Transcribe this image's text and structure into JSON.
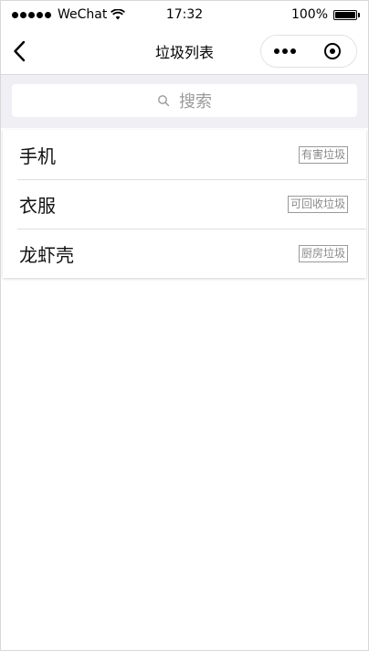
{
  "status_bar": {
    "carrier": "WeChat",
    "time": "17:32",
    "battery": "100%",
    "battery_level": 1.0
  },
  "nav": {
    "title": "垃圾列表"
  },
  "search": {
    "placeholder": "搜索"
  },
  "items": [
    {
      "name": "手机",
      "category": "有害垃圾"
    },
    {
      "name": "衣服",
      "category": "可回收垃圾"
    },
    {
      "name": "龙虾壳",
      "category": "厨房垃圾"
    }
  ],
  "colors": {
    "search_bg": "#efeff4",
    "tag_text": "#8a8a8a",
    "divider": "#dddddd"
  }
}
